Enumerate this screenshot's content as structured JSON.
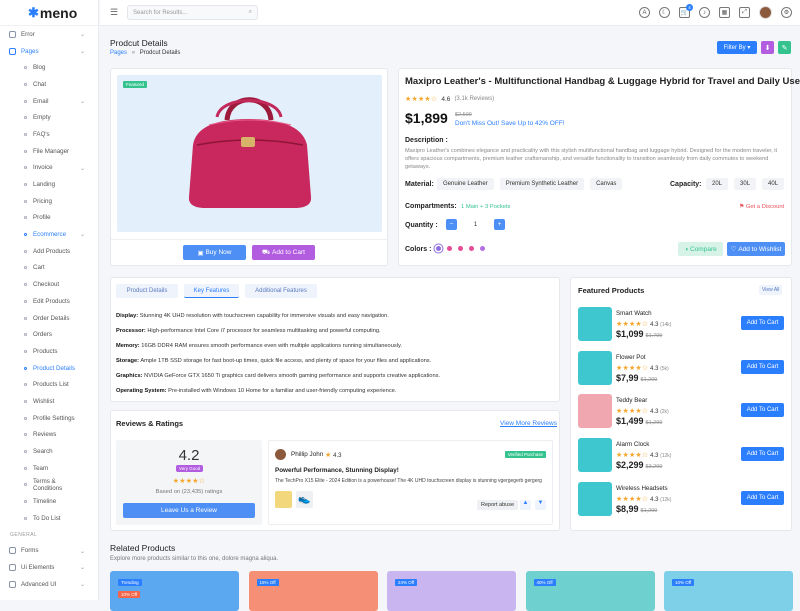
{
  "brand": {
    "name": "meno"
  },
  "sidebar": {
    "items": [
      {
        "label": "Error",
        "type": "top"
      },
      {
        "label": "Pages",
        "type": "top",
        "active": true
      },
      {
        "label": "Blog"
      },
      {
        "label": "Chat"
      },
      {
        "label": "Email"
      },
      {
        "label": "Empty"
      },
      {
        "label": "FAQ's"
      },
      {
        "label": "File Manager"
      },
      {
        "label": "Invoice"
      },
      {
        "label": "Landing"
      },
      {
        "label": "Pricing"
      },
      {
        "label": "Profile"
      },
      {
        "label": "Ecommerce",
        "active": true
      },
      {
        "label": "Add Products"
      },
      {
        "label": "Cart"
      },
      {
        "label": "Checkout"
      },
      {
        "label": "Edit Products"
      },
      {
        "label": "Order Details"
      },
      {
        "label": "Orders"
      },
      {
        "label": "Products"
      },
      {
        "label": "Product Details",
        "active": true
      },
      {
        "label": "Products List"
      },
      {
        "label": "Wishlist"
      },
      {
        "label": "Profile Settings"
      },
      {
        "label": "Reviews"
      },
      {
        "label": "Search"
      },
      {
        "label": "Team"
      },
      {
        "label": "Terms & Conditions"
      },
      {
        "label": "Timeline"
      },
      {
        "label": "To Do List"
      }
    ],
    "section_general": "GENERAL",
    "general_items": [
      {
        "label": "Forms"
      },
      {
        "label": "Ui Elements"
      },
      {
        "label": "Advanced UI"
      }
    ]
  },
  "topbar": {
    "search_placeholder": "Search for Results...",
    "cart_count": "4"
  },
  "page": {
    "title": "Prodcut Details",
    "breadcrumb_parent": "Pages",
    "breadcrumb_sep": "»",
    "breadcrumb_current": "Prodcut Details",
    "filter_label": "Filter By"
  },
  "product": {
    "featured_badge": "Featured",
    "buy_now": "Buy Now",
    "add_to_cart": "Add to Cart",
    "title": "Maxipro Leather's - Multifunctional Handbag & Luggage Hybrid for Travel and Daily Use",
    "rating": "4.6",
    "reviews": "(3.1k Reviews)",
    "old_price": "$2,599",
    "price": "$1,899",
    "deal_text": "Don't Miss Out! Save Up to 42% OFF!",
    "description_label": "Description :",
    "description": "Maxipro Leather's combines elegance and practicality with this stylish multifunctional handbag and luggage hybrid. Designed for the modern traveler, it offers spacious compartments, premium leather craftsmanship, and versatile functionality to transition seamlessly from daily commutes to weekend getaways.",
    "material_label": "Material:",
    "materials": [
      "Genuine Leather",
      "Premium Synthetic Leather",
      "Canvas"
    ],
    "capacity_label": "Capacity:",
    "capacities": [
      "20L",
      "30L",
      "40L"
    ],
    "compartments_label": "Compartments:",
    "compartments_value": "1 Main + 3 Pockets",
    "discount_link": "Get a Discount",
    "quantity_label": "Quantity :",
    "quantity": "1",
    "colors_label": "Colors :",
    "colors": [
      "#8e6ee0",
      "#e64c94",
      "#e64c94",
      "#e64c94",
      "#b36ee0"
    ],
    "compare": "Compare",
    "wishlist": "Add to Wishlist"
  },
  "details": {
    "tabs": [
      "Product Details",
      "Key Features",
      "Additional Features"
    ],
    "specs": [
      {
        "k": "Display:",
        "v": "Stunning 4K UHD resolution with touchscreen capability for immersive visuals and easy navigation."
      },
      {
        "k": "Processor:",
        "v": "High-performance Intel Core i7 processor for seamless multitasking and powerful computing."
      },
      {
        "k": "Memory:",
        "v": "16GB DDR4 RAM ensures smooth performance even with multiple applications running simultaneously."
      },
      {
        "k": "Storage:",
        "v": "Ample 1TB SSD storage for fast boot-up times, quick file access, and plenty of space for your files and applications."
      },
      {
        "k": "Graphics:",
        "v": "NVIDIA GeForce GTX 1650 Ti graphics card delivers smooth gaming performance and supports creative applications."
      },
      {
        "k": "Operating System:",
        "v": "Pre-installed with Windows 10 Home for a familiar and user-friendly computing experience."
      }
    ]
  },
  "reviews": {
    "title": "Reviews & Ratings",
    "more_link": "View More Reviews",
    "score": "4.2",
    "score_badge": "Very Good",
    "based_on": "Based on (23,435) ratings",
    "leave_review": "Leave Us a Review",
    "reviewer": "Phillip John",
    "reviewer_rating": "4.3",
    "verified": "Verified Purchase",
    "review_title": "Powerful Performance, Stunning Display!",
    "review_body": "The TechPro X15 Elite - 2024 Edition is a powerhouse! The 4K UHD touchscreen display is stunning vgergegerb gergerg",
    "report": "Report abuse"
  },
  "featured": {
    "title": "Featured Products",
    "view_all": "View All",
    "items": [
      {
        "name": "Smart Watch",
        "rating": "4.3",
        "count": "(14k)",
        "price": "$1,099",
        "old": "$1,799",
        "color": "#3ec7cf"
      },
      {
        "name": "Flower Pot",
        "rating": "4.3",
        "count": "(5k)",
        "price": "$7,99",
        "old": "$1,299",
        "color": "#3ec7cf"
      },
      {
        "name": "Teddy Bear",
        "rating": "4.3",
        "count": "(2k)",
        "price": "$1,499",
        "old": "$1,299",
        "color": "#f0a7b0"
      },
      {
        "name": "Alarm Clock",
        "rating": "4.3",
        "count": "(12k)",
        "price": "$2,299",
        "old": "$3,299",
        "color": "#3ec7cf"
      },
      {
        "name": "Wireless Headsets",
        "rating": "4.3",
        "count": "(12k)",
        "price": "$8,99",
        "old": "$1,299",
        "color": "#3ec7cf"
      }
    ],
    "button": "Add To Cart"
  },
  "related": {
    "title": "Related Products",
    "subtitle": "Explore more products similar to this one, dolore magna aliqua.",
    "cards": [
      {
        "tag": "Trending",
        "tag2": "10% Off",
        "color": "#5ba8f0"
      },
      {
        "tag": "15% Off",
        "color": "#f58f75"
      },
      {
        "tag": "24% Off",
        "color": "#c9b5f0"
      },
      {
        "tag": "40% Off",
        "color": "#6fd0d0"
      },
      {
        "tag": "10% Off",
        "color": "#7ecfe8"
      }
    ]
  }
}
